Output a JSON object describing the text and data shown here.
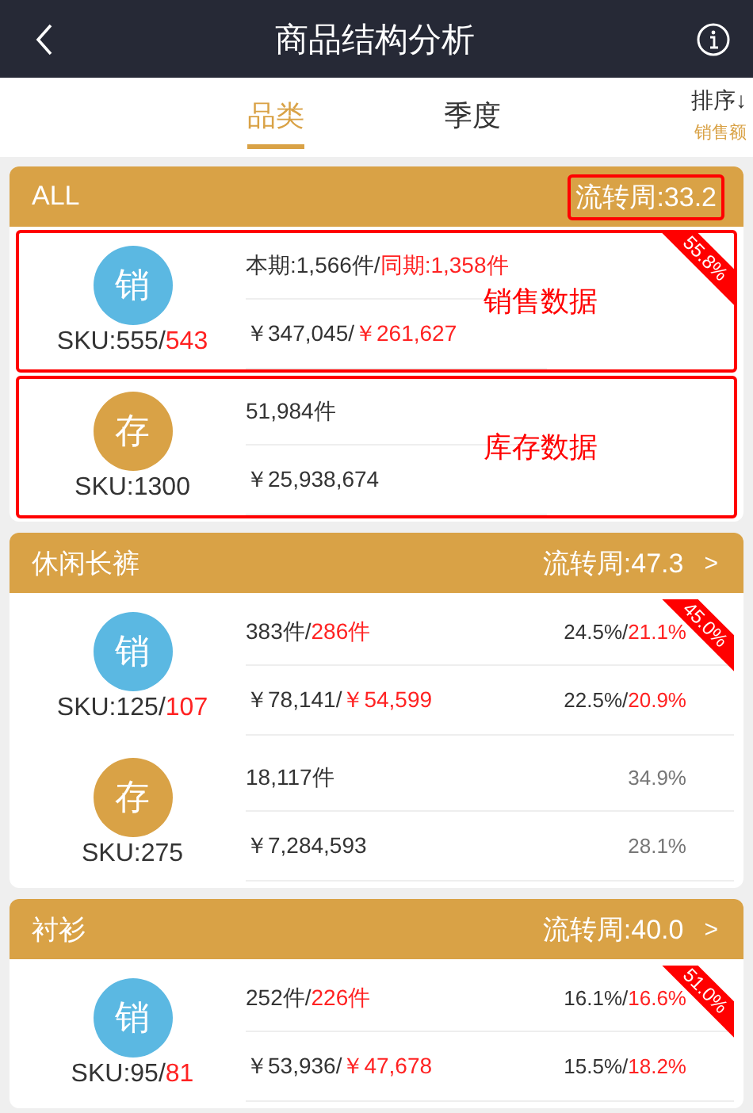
{
  "header": {
    "title": "商品结构分析"
  },
  "tabs": [
    {
      "label": "品类",
      "selected": true
    },
    {
      "label": "季度",
      "selected": false
    }
  ],
  "sort": {
    "label": "排序↓",
    "value": "销售额"
  },
  "groups": [
    {
      "name": "ALL",
      "turnover": "流转周:33.2",
      "turnover_boxed": true,
      "sales": {
        "badge": "销",
        "ribbon": "55.8%",
        "sku": "SKU:555/",
        "sku_prev": "543",
        "qty": "本期:1,566件/",
        "qty_prev": "同期:1,358件",
        "amount": "￥347,045/",
        "amount_prev": " ￥261,627",
        "note": "销售数据"
      },
      "stock": {
        "badge": "存",
        "sku": "SKU:1300",
        "qty": "51,984件",
        "amount": "￥25,938,674",
        "note": "库存数据"
      }
    },
    {
      "name": "休闲长裤",
      "turnover": "流转周:47.3",
      "turnover_boxed": false,
      "more": ">",
      "sales": {
        "badge": "销",
        "ribbon": "45.0%",
        "sku": "SKU:125/",
        "sku_prev": "107",
        "qty": "383件/",
        "qty_prev": "286件",
        "qty_share": "24.5%/",
        "qty_share_prev": "21.1%",
        "amount": "￥78,141/",
        "amount_prev": " ￥54,599",
        "amount_share": "22.5%/",
        "amount_share_prev": "20.9%"
      },
      "stock": {
        "badge": "存",
        "sku": "SKU:275",
        "qty": "18,117件",
        "amount": "￥7,284,593",
        "qty_share": "34.9%",
        "amount_share": "28.1%"
      }
    },
    {
      "name": "衬衫",
      "turnover": "流转周:40.0",
      "turnover_boxed": false,
      "more": ">",
      "sales": {
        "badge": "销",
        "ribbon": "51.0%",
        "sku": "SKU:95/",
        "sku_prev": "81",
        "qty": "252件/",
        "qty_prev": "226件",
        "qty_share": "16.1%/",
        "qty_share_prev": "16.6%",
        "amount": "￥53,936/",
        "amount_prev": " ￥47,678",
        "amount_share": "15.5%/",
        "amount_share_prev": "18.2%"
      }
    }
  ]
}
